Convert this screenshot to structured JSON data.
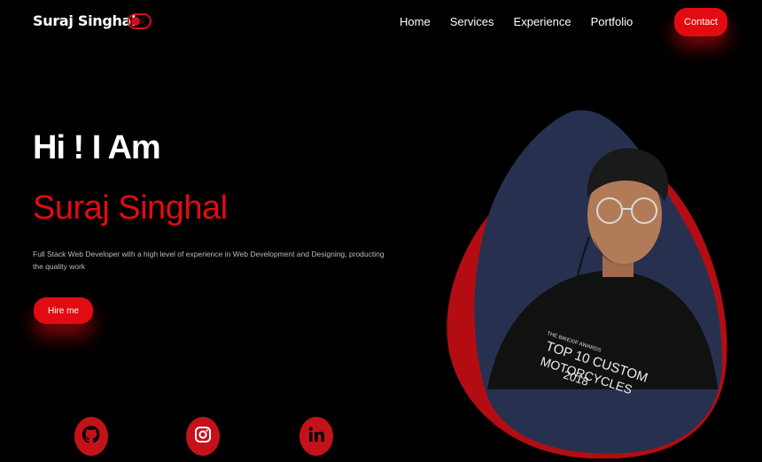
{
  "nav": {
    "brand": "Suraj Singhal",
    "links": [
      "Home",
      "Services",
      "Experience",
      "Portfolio"
    ],
    "contact_label": "Contact"
  },
  "hero": {
    "greeting": "Hi ! I Am",
    "name": "Suraj Singhal",
    "description": "Full Stack Web Developer with a high level of experience in Web Development and Designing, producting the quality work",
    "hire_label": "Hire me"
  },
  "portrait": {
    "shirt_lines": [
      "THE BIKEXIF AWARDS",
      "TOP 10 CUSTOM",
      "MOTORCYCLES",
      "2018"
    ]
  },
  "social": [
    "github-icon",
    "instagram-icon",
    "linkedin-icon"
  ],
  "colors": {
    "accent": "#e30b12",
    "blob": "#27314f",
    "background": "#000000"
  }
}
